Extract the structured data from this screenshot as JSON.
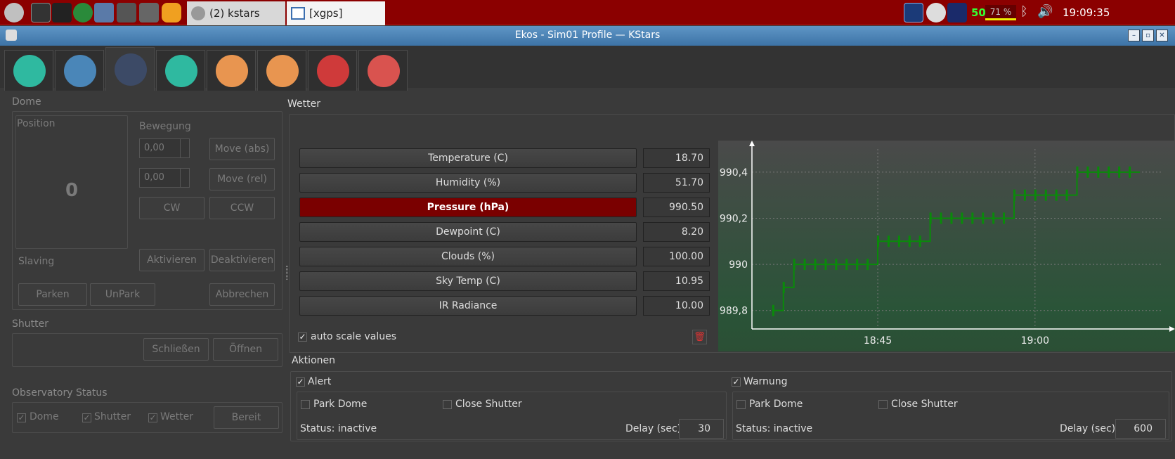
{
  "window_title": "Ekos - Sim01 Profile — KStars",
  "taskbar": {
    "tasks": [
      "(2) kstars",
      "[xgps]"
    ],
    "tray_number": "50",
    "tray_percent": "71 %",
    "clock": "19:09:35"
  },
  "tabs": [
    "setup",
    "scheduler",
    "observatory",
    "mount",
    "capture",
    "focus",
    "align",
    "guide"
  ],
  "dome": {
    "group": "Dome",
    "position_label": "Position",
    "position_value": "0",
    "bewegung_label": "Bewegung",
    "abs_value": "0,00",
    "rel_value": "0,00",
    "move_abs": "Move (abs)",
    "move_rel": "Move (rel)",
    "cw": "CW",
    "ccw": "CCW",
    "slaving_label": "Slaving",
    "aktivieren": "Aktivieren",
    "deaktivieren": "Deaktivieren",
    "parken": "Parken",
    "unpark": "UnPark",
    "abbrechen": "Abbrechen"
  },
  "shutter": {
    "group": "Shutter",
    "schliessen": "Schließen",
    "offnen": "Öffnen"
  },
  "obs_status": {
    "group": "Observatory Status",
    "dome": "Dome",
    "shutter": "Shutter",
    "wetter": "Wetter",
    "bereit": "Bereit"
  },
  "weather": {
    "group": "Wetter",
    "params": [
      {
        "label": "Temperature (C)",
        "value": "18.70"
      },
      {
        "label": "Humidity (%)",
        "value": "51.70"
      },
      {
        "label": "Pressure (hPa)",
        "value": "990.50"
      },
      {
        "label": "Dewpoint (C)",
        "value": "8.20"
      },
      {
        "label": "Clouds (%)",
        "value": "100.00"
      },
      {
        "label": "Sky Temp (C)",
        "value": "10.95"
      },
      {
        "label": "IR Radiance",
        "value": "10.00"
      }
    ],
    "auto_scale": "auto scale values"
  },
  "chart_data": {
    "type": "line",
    "ylim": [
      989.72,
      990.5
    ],
    "yticks": [
      "989,8",
      "990",
      "990,2",
      "990,4"
    ],
    "xticks": [
      "18:45",
      "19:00"
    ],
    "grid": true,
    "color": "#0a8a0a",
    "series": [
      {
        "x": [
          "18:35",
          "18:36",
          "18:37",
          "18:38",
          "18:39",
          "18:40",
          "18:41",
          "18:42",
          "18:43",
          "18:44",
          "18:45",
          "18:46",
          "18:47",
          "18:48",
          "18:49",
          "18:50",
          "18:51",
          "18:52",
          "18:53",
          "18:54",
          "18:55",
          "18:56",
          "18:57",
          "18:58",
          "18:59",
          "19:00",
          "19:01",
          "19:02",
          "19:03",
          "19:04",
          "19:05",
          "19:06",
          "19:07",
          "19:08",
          "19:09"
        ],
        "values": [
          989.8,
          989.9,
          990.0,
          990.0,
          990.0,
          990.0,
          990.0,
          990.0,
          990.0,
          990.0,
          990.1,
          990.1,
          990.1,
          990.1,
          990.1,
          990.2,
          990.2,
          990.2,
          990.2,
          990.2,
          990.2,
          990.2,
          990.2,
          990.3,
          990.3,
          990.3,
          990.3,
          990.3,
          990.3,
          990.4,
          990.4,
          990.4,
          990.4,
          990.4,
          990.4
        ]
      }
    ]
  },
  "aktionen": {
    "group": "Aktionen",
    "alert": {
      "title": "Alert",
      "park": "Park Dome",
      "close": "Close Shutter",
      "status": "Status: inactive",
      "delay_label": "Delay (sec):",
      "delay": "30"
    },
    "warnung": {
      "title": "Warnung",
      "park": "Park Dome",
      "close": "Close Shutter",
      "status": "Status: inactive",
      "delay_label": "Delay (sec):",
      "delay": "600"
    }
  }
}
